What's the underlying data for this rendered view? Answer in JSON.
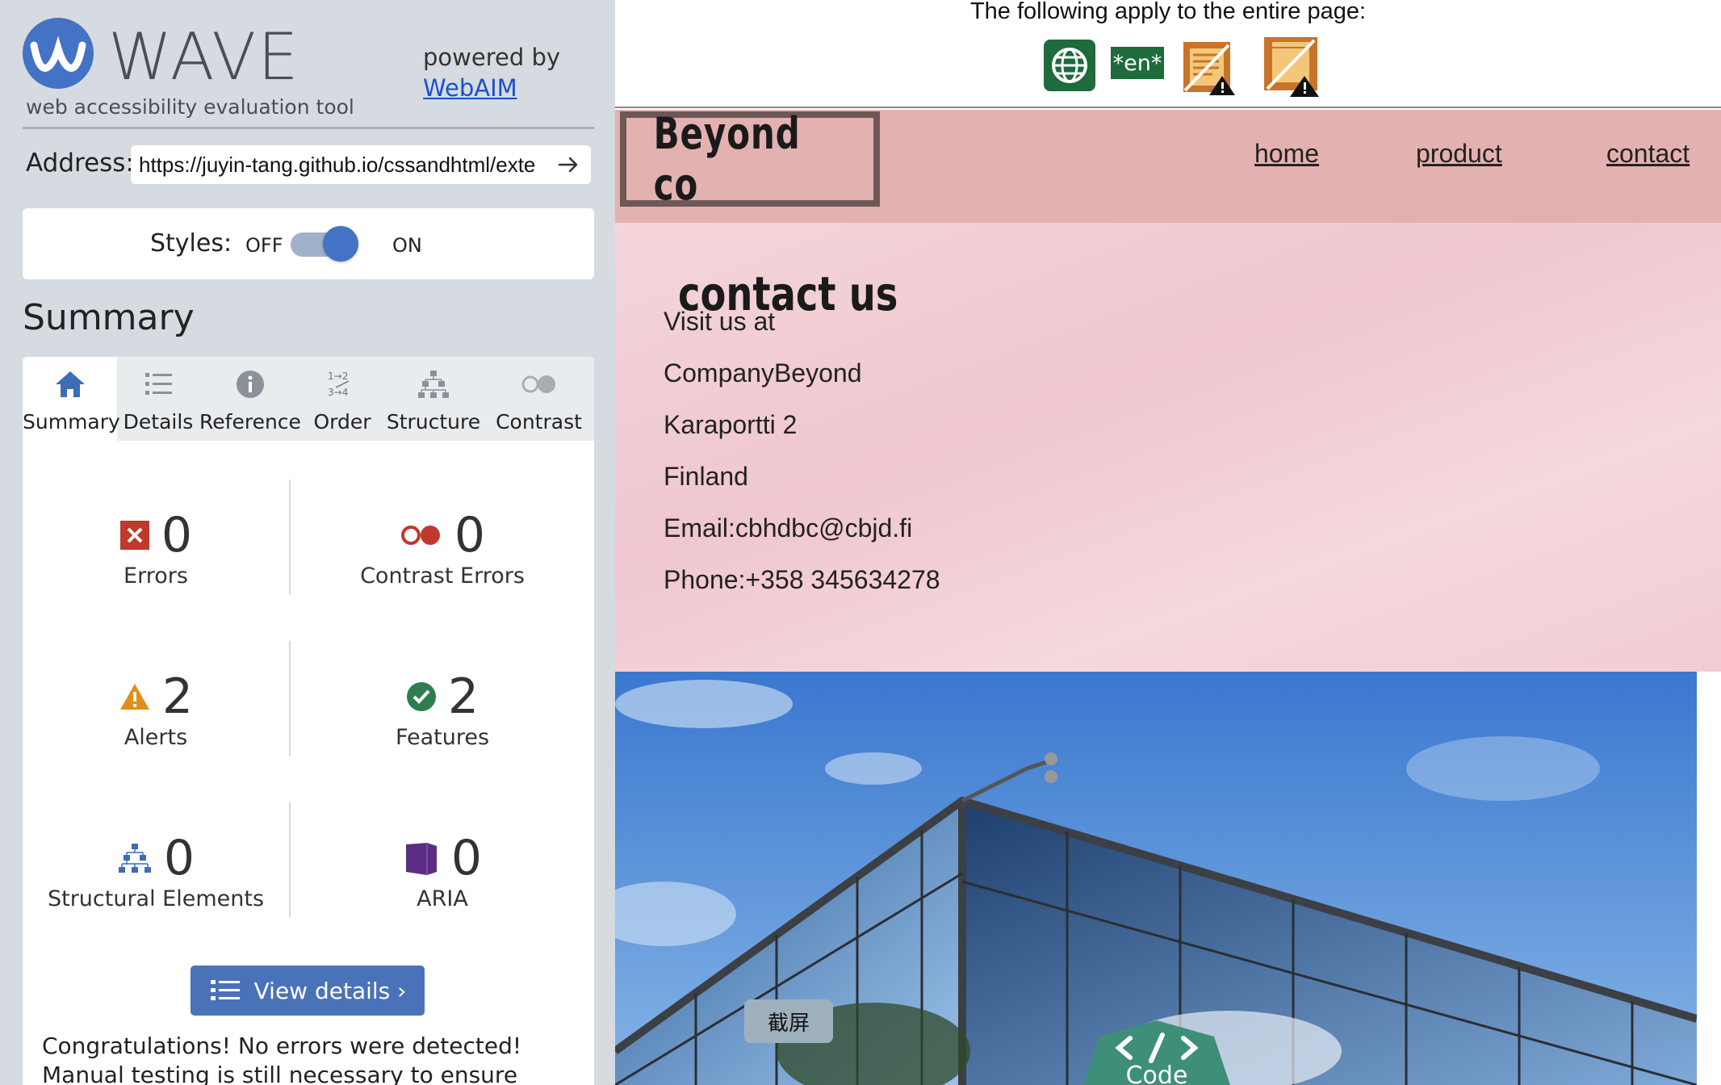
{
  "wave": {
    "logo_text": "WAVE",
    "tagline": "web accessibility evaluation tool",
    "powered_by": "powered by",
    "webaim_link": "WebAIM",
    "address_label": "Address:",
    "address_value": "https://juyin-tang.github.io/cssandhtml/exte",
    "styles_label": "Styles:",
    "styles_off": "OFF",
    "styles_on": "ON",
    "summary_heading": "Summary",
    "tabs": [
      {
        "label": "Summary",
        "icon": "home-icon",
        "active": true
      },
      {
        "label": "Details",
        "icon": "list-icon"
      },
      {
        "label": "Reference",
        "icon": "info-icon"
      },
      {
        "label": "Order",
        "icon": "order-icon"
      },
      {
        "label": "Structure",
        "icon": "structure-icon"
      },
      {
        "label": "Contrast",
        "icon": "contrast-icon"
      }
    ],
    "stats": {
      "errors": {
        "count": "0",
        "label": "Errors"
      },
      "contrast_errors": {
        "count": "0",
        "label": "Contrast Errors"
      },
      "alerts": {
        "count": "2",
        "label": "Alerts"
      },
      "features": {
        "count": "2",
        "label": "Features"
      },
      "structural": {
        "count": "0",
        "label": "Structural Elements"
      },
      "aria": {
        "count": "0",
        "label": "ARIA"
      }
    },
    "view_details": "View details ›",
    "congrats": "Congratulations! No errors were detected! Manual testing is still necessary to ensure compliance and"
  },
  "page_bar": {
    "text": "The following apply to the entire page:",
    "lang_badge": "*en*",
    "icons": [
      "language-icon",
      "lang-attribute-icon",
      "document-alert-icon",
      "no-title-alert-icon"
    ]
  },
  "site": {
    "logo": "Beyond co",
    "nav": [
      "home",
      "product",
      "contact"
    ],
    "heading": "contact us",
    "lines": [
      "Visit us at",
      "CompanyBeyond",
      "Karaportti 2",
      "Finland",
      "Email:cbhdbc@cbjd.fi",
      "Phone:+358 345634278"
    ]
  },
  "overlays": {
    "screenshot_tip": "截屏",
    "code_badge": "Code"
  },
  "colors": {
    "wave_blue": "#4472c4",
    "sidebar_bg": "#d5dbe0",
    "site_header": "#e3b1b0",
    "site_pink": "#f0c7cf",
    "error_red": "#c0392b",
    "alert_orange": "#e08e1b",
    "feature_green": "#2e7d4f",
    "aria_purple": "#5b2d83"
  }
}
